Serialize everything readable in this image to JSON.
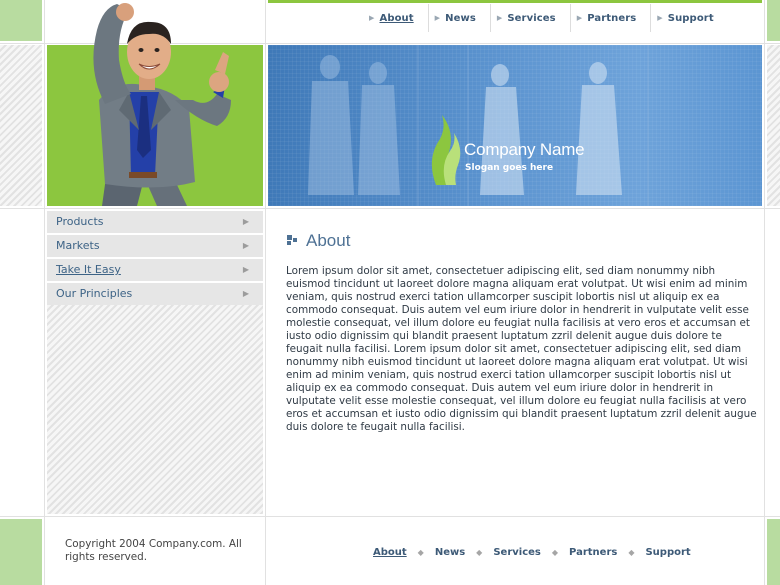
{
  "top_nav": [
    {
      "label": "About",
      "active": true
    },
    {
      "label": "News",
      "active": false
    },
    {
      "label": "Services",
      "active": false
    },
    {
      "label": "Partners",
      "active": false
    },
    {
      "label": "Support",
      "active": false
    }
  ],
  "banner": {
    "company_name": "Company Name",
    "slogan": "Slogan goes here"
  },
  "side_menu": [
    {
      "label": "Products",
      "active": false
    },
    {
      "label": "Markets",
      "active": false
    },
    {
      "label": "Take It Easy",
      "active": true
    },
    {
      "label": "Our Principles",
      "active": false
    }
  ],
  "content": {
    "title": "About",
    "body": "Lorem ipsum dolor sit amet, consectetuer adipiscing elit, sed diam nonummy nibh euismod tincidunt ut laoreet dolore magna aliquam erat volutpat. Ut wisi enim ad minim veniam, quis nostrud exerci tation ullamcorper suscipit lobortis nisl ut aliquip ex ea commodo consequat. Duis autem vel eum iriure dolor in hendrerit in vulputate velit esse molestie consequat, vel illum dolore eu feugiat nulla facilisis at vero eros et accumsan et iusto odio dignissim qui blandit praesent luptatum zzril delenit augue duis dolore te feugait nulla facilisi. Lorem ipsum dolor sit amet, consectetuer adipiscing elit, sed diam nonummy nibh euismod tincidunt ut laoreet dolore magna aliquam erat volutpat. Ut wisi enim ad minim veniam, quis nostrud exerci tation ullamcorper suscipit lobortis nisl ut aliquip ex ea commodo consequat. Duis autem vel eum iriure dolor in hendrerit in vulputate velit esse molestie consequat, vel illum dolore eu feugiat nulla facilisis at vero eros et accumsan et iusto odio dignissim qui blandit praesent luptatum zzril delenit augue duis dolore te feugait nulla facilisi."
  },
  "footer": {
    "copyright": "Copyright 2004 Company.com. All rights reserved.",
    "nav": [
      {
        "label": "About",
        "active": true
      },
      {
        "label": "News",
        "active": false
      },
      {
        "label": "Services",
        "active": false
      },
      {
        "label": "Partners",
        "active": false
      },
      {
        "label": "Support",
        "active": false
      }
    ]
  },
  "icons": {
    "nav_arrow": "triangle-right-icon",
    "menu_chevron": "chevron-right-icon",
    "footer_separator": "diamond-bullet-icon",
    "title_bullet": "square-bullet-icon",
    "logo": "flame-logo-icon"
  },
  "colors": {
    "accent_green": "#8cc63f",
    "pale_green": "#b8dca0",
    "banner_blue": "#5b93cf",
    "link_blue": "#3d5a77"
  }
}
